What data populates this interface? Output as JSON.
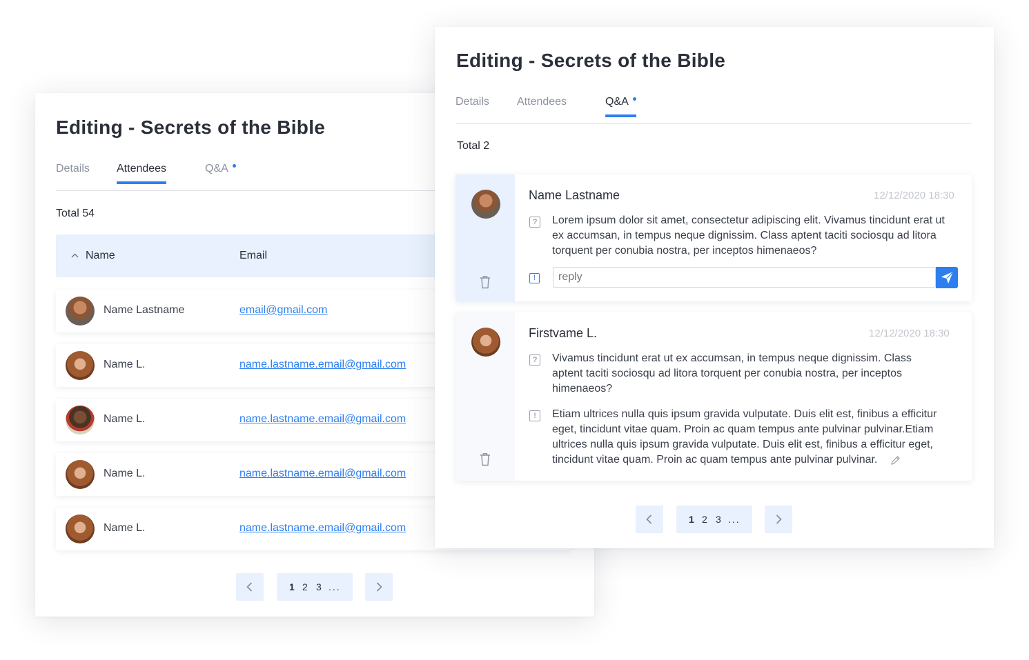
{
  "title": "Editing - Secrets of the Bible",
  "tabs": [
    "Details",
    "Attendees",
    "Q&A"
  ],
  "attendees_view": {
    "total": "Total 54",
    "headers": {
      "name": "Name",
      "email": "Email"
    },
    "rows": [
      {
        "name": "Name Lastname",
        "email": "email@gmail.com"
      },
      {
        "name": "Name L.",
        "email": "name.lastname.email@gmail.com"
      },
      {
        "name": "Name L.",
        "email": "name.lastname.email@gmail.com"
      },
      {
        "name": "Name L.",
        "email": "name.lastname.email@gmail.com"
      },
      {
        "name": "Name L.",
        "email": "name.lastname.email@gmail.com"
      }
    ]
  },
  "qa_view": {
    "total": "Total 2",
    "items": [
      {
        "name": "Name Lastname",
        "date": "12/12/2020  18:30",
        "question": "Lorem ipsum dolor sit amet, consectetur adipiscing elit. Vivamus tincidunt erat ut ex accumsan, in tempus neque dignissim. Class aptent taciti sociosqu ad litora torquent per conubia nostra, per inceptos himenaeos?",
        "reply_placeholder": "reply"
      },
      {
        "name": "Firstvame L.",
        "date": "12/12/2020  18:30",
        "question": "Vivamus tincidunt erat ut ex accumsan, in tempus neque dignissim. Class aptent taciti sociosqu ad litora torquent per conubia nostra, per inceptos himenaeos?",
        "answer": "Etiam ultrices nulla quis ipsum gravida vulputate. Duis elit est, finibus a efficitur eget, tincidunt vitae quam. Proin ac quam tempus ante pulvinar pulvinar.Etiam ultrices nulla quis ipsum gravida vulputate. Duis elit est, finibus a efficitur eget, tincidunt vitae quam. Proin ac quam tempus ante pulvinar pulvinar."
      }
    ]
  },
  "pagination": {
    "pages": [
      "1",
      "2",
      "3"
    ],
    "ellipsis": "..."
  },
  "icons": {
    "sort": "chevron-up-icon",
    "prev": "chevron-left-icon",
    "next": "chevron-right-icon",
    "delete": "trash-icon",
    "question": "question-icon",
    "answer": "exclamation-icon",
    "send": "send-icon",
    "edit": "pencil-icon"
  },
  "colors": {
    "accent": "#2d7ff0",
    "header_bg": "#e8f1fd",
    "text": "#2b2f3a",
    "muted": "#8b92a0"
  }
}
